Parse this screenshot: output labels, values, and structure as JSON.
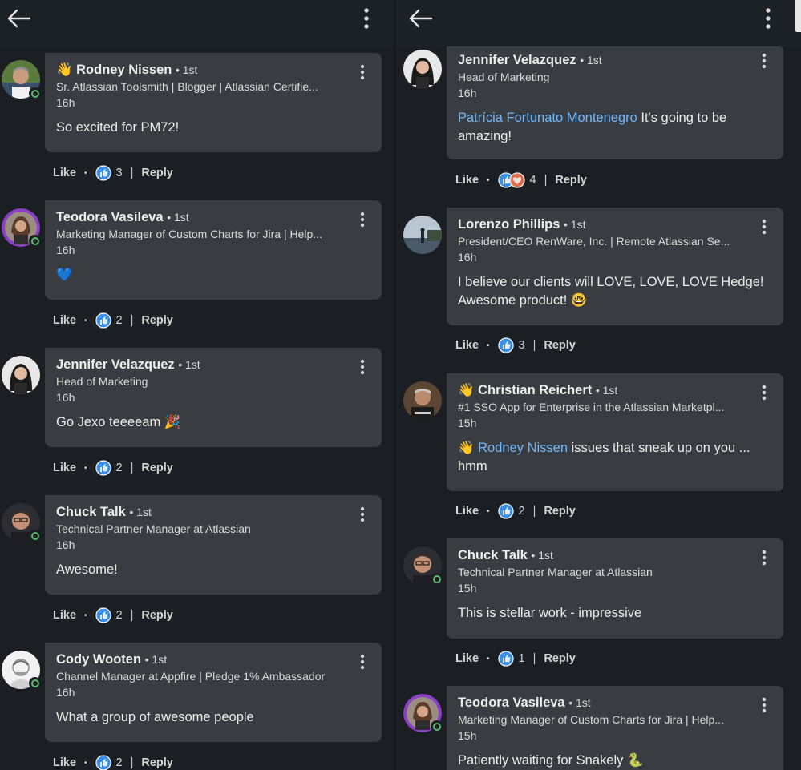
{
  "actions": {
    "like": "Like",
    "reply": "Reply",
    "separator": "|",
    "dot": "•"
  },
  "colors": {
    "background": "#1b1f23",
    "bubble": "#393d41",
    "mention": "#71b7fb",
    "online": "#5fbb6f",
    "like_blue": "#378fe9"
  },
  "left_pane": {
    "comments": [
      {
        "emoji": "👋",
        "name": "Rodney Nissen",
        "degree": "• 1st",
        "headline": "Sr. Atlassian Toolsmith | Blogger | Atlassian Certifie...",
        "time": "16h",
        "body": "So excited for PM72!",
        "reactions": "3",
        "reaction_icons": [
          "like-icon"
        ],
        "online": true
      },
      {
        "name": "Teodora Vasileva",
        "degree": "• 1st",
        "headline": "Marketing Manager of Custom Charts for Jira | Help...",
        "time": "16h",
        "body": "💙",
        "reactions": "2",
        "reaction_icons": [
          "like-icon"
        ],
        "online": true
      },
      {
        "name": "Jennifer Velazquez",
        "degree": "• 1st",
        "headline": "Head of Marketing",
        "time": "16h",
        "body": "Go Jexo teeeeam 🎉",
        "reactions": "2",
        "reaction_icons": [
          "like-icon"
        ],
        "online": false
      },
      {
        "name": "Chuck Talk",
        "degree": "• 1st",
        "headline": "Technical Partner Manager at Atlassian",
        "time": "16h",
        "body": "Awesome!",
        "reactions": "2",
        "reaction_icons": [
          "like-icon"
        ],
        "online": true
      },
      {
        "name": "Cody Wooten",
        "degree": "• 1st",
        "headline": "Channel Manager at Appfire | Pledge 1% Ambassador",
        "time": "16h",
        "body": "What a group of awesome people",
        "reactions": "2",
        "reaction_icons": [
          "like-icon"
        ],
        "online": true
      }
    ]
  },
  "right_pane": {
    "comments": [
      {
        "name": "Jennifer Velazquez",
        "degree": "• 1st",
        "headline": "Head of Marketing",
        "time": "16h",
        "mention": "Patrícia Fortunato Montenegro",
        "body": "It's going to be amazing!",
        "reactions": "4",
        "reaction_icons": [
          "like-icon",
          "love-icon"
        ],
        "online": false
      },
      {
        "name": "Lorenzo Phillips",
        "degree": "• 1st",
        "headline": "President/CEO RenWare, Inc. | Remote Atlassian Se...",
        "time": "16h",
        "body": "I believe our clients will LOVE, LOVE, LOVE Hedge! Awesome product! 🤓",
        "reactions": "3",
        "reaction_icons": [
          "like-icon"
        ],
        "online": false
      },
      {
        "emoji": "👋",
        "name": "Christian Reichert",
        "degree": "• 1st",
        "headline": "#1 SSO App for Enterprise in the Atlassian Marketpl...",
        "time": "15h",
        "body_prefix": "👋",
        "mention": "Rodney Nissen",
        "body": "issues that sneak up on you ... hmm",
        "reactions": "2",
        "reaction_icons": [
          "like-icon"
        ],
        "online": false
      },
      {
        "name": "Chuck Talk",
        "degree": "• 1st",
        "headline": "Technical Partner Manager at Atlassian",
        "time": "15h",
        "body": "This is stellar work - impressive",
        "reactions": "1",
        "reaction_icons": [
          "like-icon"
        ],
        "online": true
      },
      {
        "name": "Teodora Vasileva",
        "degree": "• 1st",
        "headline": "Marketing Manager of Custom Charts for Jira | Help...",
        "time": "15h",
        "body": "Patiently waiting for Snakely 🐍",
        "reactions": "",
        "reaction_icons": [],
        "online": true
      }
    ]
  }
}
